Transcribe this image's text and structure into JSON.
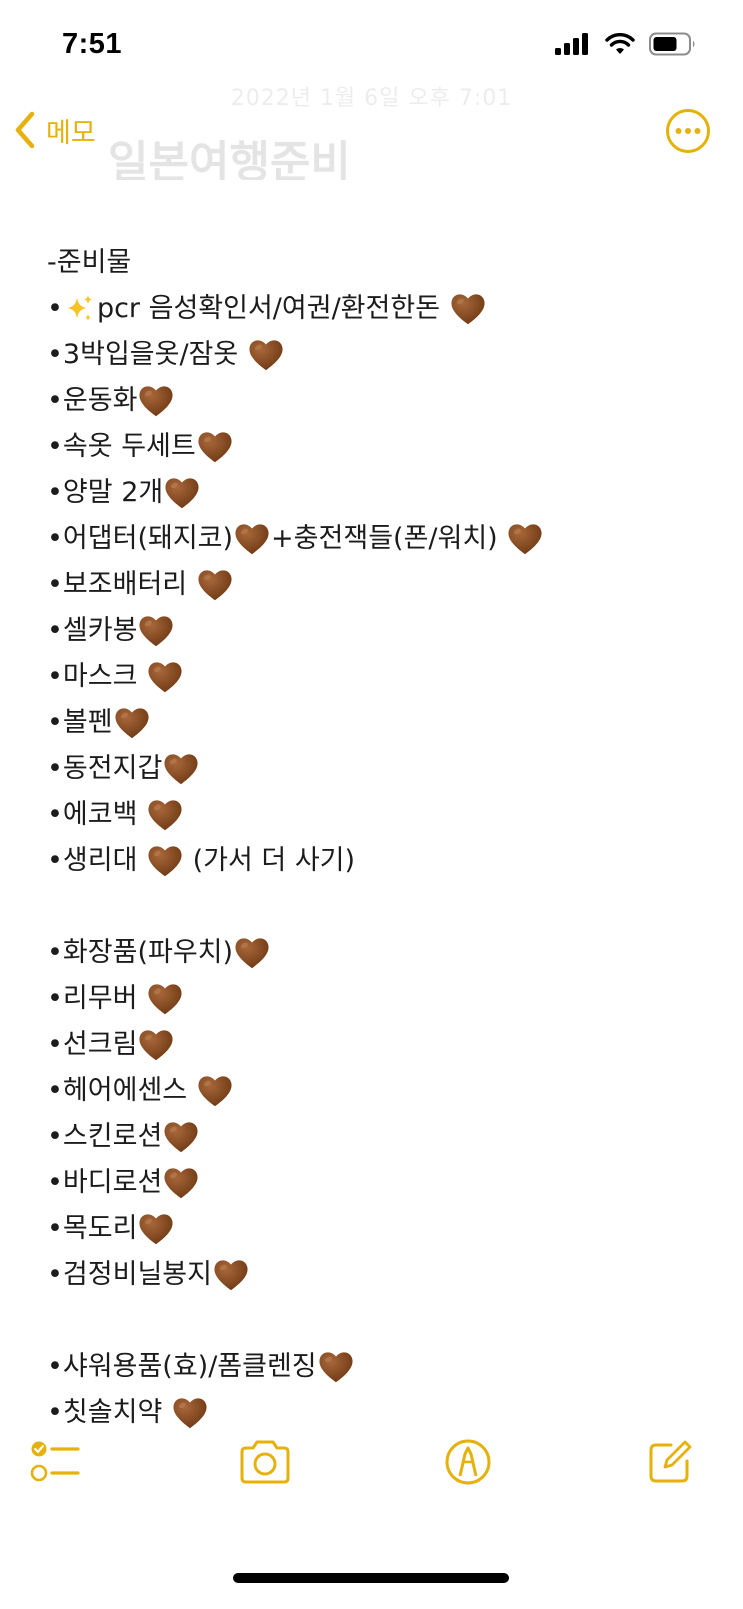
{
  "status_bar": {
    "time": "7:51"
  },
  "nav": {
    "back_label": "메모"
  },
  "note": {
    "faded_date": "2022년 1월 6일 오후 7:01",
    "faded_title": "일본여행준비",
    "lines": [
      {
        "text": "-준비물",
        "heart": false
      },
      {
        "text": "•",
        "sparkle": true,
        "after": "pcr 음성확인서/여권/환전한돈 ",
        "heart": true
      },
      {
        "text": "•3박입을옷/잠옷 ",
        "heart": true
      },
      {
        "text": "•운동화",
        "heart": true
      },
      {
        "text": "•속옷 두세트",
        "heart": true
      },
      {
        "text": "•양말 2개",
        "heart": true
      },
      {
        "text": "•어댑터(돼지코)",
        "heart": true,
        "after_heart": "+충전잭들(폰/워치) ",
        "heart2": true
      },
      {
        "text": "•보조배터리 ",
        "heart": true
      },
      {
        "text": "•셀카봉",
        "heart": true
      },
      {
        "text": "•마스크 ",
        "heart": true
      },
      {
        "text": "•볼펜",
        "heart": true
      },
      {
        "text": "•동전지갑",
        "heart": true
      },
      {
        "text": "•에코백 ",
        "heart": true
      },
      {
        "text": "•생리대 ",
        "heart": true,
        "after_heart": " (가서 더 사기)"
      },
      {
        "text": "",
        "blank": true
      },
      {
        "text": "•화장품(파우치)",
        "heart": true
      },
      {
        "text": "•리무버 ",
        "heart": true
      },
      {
        "text": "•선크림",
        "heart": true
      },
      {
        "text": "•헤어에센스 ",
        "heart": true
      },
      {
        "text": "•스킨로션",
        "heart": true
      },
      {
        "text": "•바디로션",
        "heart": true
      },
      {
        "text": "•목도리",
        "heart": true
      },
      {
        "text": "•검정비닐봉지",
        "heart": true
      },
      {
        "text": "",
        "blank": true
      },
      {
        "text": "•샤워용품(효)/폼클렌징",
        "heart": true
      },
      {
        "text": "•칫솔치약 ",
        "heart": true
      }
    ]
  },
  "toolbar": {
    "checklist_icon": "checklist-icon",
    "camera_icon": "camera-icon",
    "markup_icon": "markup-pen-icon",
    "compose_icon": "compose-icon"
  },
  "colors": {
    "accent": "#e5b10a",
    "heart": "#8a4b1f",
    "text": "#1c1c1e"
  }
}
